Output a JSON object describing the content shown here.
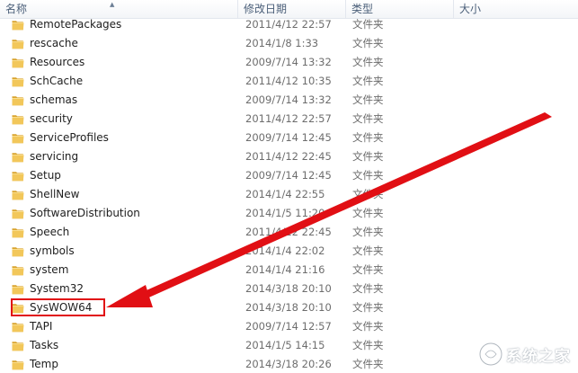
{
  "columns": {
    "name": "名称",
    "date_modified": "修改日期",
    "type": "类型",
    "size": "大小"
  },
  "rows": [
    {
      "name": "RemotePackages",
      "date": "2011/4/12 22:57",
      "type": "文件夹"
    },
    {
      "name": "rescache",
      "date": "2014/1/8 1:33",
      "type": "文件夹"
    },
    {
      "name": "Resources",
      "date": "2009/7/14 13:32",
      "type": "文件夹"
    },
    {
      "name": "SchCache",
      "date": "2011/4/12 10:35",
      "type": "文件夹"
    },
    {
      "name": "schemas",
      "date": "2009/7/14 13:32",
      "type": "文件夹"
    },
    {
      "name": "security",
      "date": "2011/4/12 22:57",
      "type": "文件夹"
    },
    {
      "name": "ServiceProfiles",
      "date": "2009/7/14 12:45",
      "type": "文件夹"
    },
    {
      "name": "servicing",
      "date": "2011/4/12 22:45",
      "type": "文件夹"
    },
    {
      "name": "Setup",
      "date": "2009/7/14 12:45",
      "type": "文件夹"
    },
    {
      "name": "ShellNew",
      "date": "2014/1/4 22:55",
      "type": "文件夹"
    },
    {
      "name": "SoftwareDistribution",
      "date": "2014/1/5 11:20",
      "type": "文件夹"
    },
    {
      "name": "Speech",
      "date": "2011/4/12 22:45",
      "type": "文件夹"
    },
    {
      "name": "symbols",
      "date": "2014/1/4 22:02",
      "type": "文件夹"
    },
    {
      "name": "system",
      "date": "2014/1/4 21:16",
      "type": "文件夹"
    },
    {
      "name": "System32",
      "date": "2014/3/18 20:10",
      "type": "文件夹"
    },
    {
      "name": "SysWOW64",
      "date": "2014/3/18 20:10",
      "type": "文件夹",
      "highlighted": true
    },
    {
      "name": "TAPI",
      "date": "2009/7/14 12:57",
      "type": "文件夹"
    },
    {
      "name": "Tasks",
      "date": "2014/1/5 14:15",
      "type": "文件夹"
    },
    {
      "name": "Temp",
      "date": "2014/3/18 20:26",
      "type": "文件夹"
    }
  ],
  "annotation_color": "#e10f14",
  "folder_color": "#e8b942",
  "watermark": {
    "text": "系统之家",
    "icon": "xitongzhijia-logo-icon"
  }
}
